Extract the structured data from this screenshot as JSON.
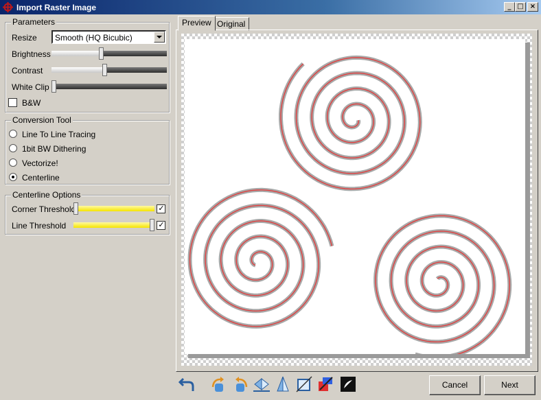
{
  "window": {
    "title": "Import Raster Image"
  },
  "parameters": {
    "title": "Parameters",
    "resize_label": "Resize",
    "resize_value": "Smooth (HQ Bicubic)",
    "brightness_label": "Brightness",
    "brightness_level": 0.43,
    "contrast_label": "Contrast",
    "contrast_level": 0.46,
    "whiteclip_label": "White Clip",
    "whiteclip_level": 0.0,
    "bw_label": "B&W",
    "bw_checked": false
  },
  "conversion": {
    "title": "Conversion Tool",
    "options": [
      {
        "label": "Line To Line Tracing",
        "selected": false
      },
      {
        "label": "1bit BW Dithering",
        "selected": false
      },
      {
        "label": "Vectorize!",
        "selected": false
      },
      {
        "label": "Centerline",
        "selected": true
      }
    ]
  },
  "centerline": {
    "title": "Centerline Options",
    "corner_label": "Corner Threshold",
    "corner_level": 0.0,
    "corner_checked": true,
    "line_label": "Line Threshold",
    "line_level": 1.0,
    "line_checked": true
  },
  "tabs": [
    {
      "label": "Preview",
      "active": true
    },
    {
      "label": "Original",
      "active": false
    }
  ],
  "toolbar_icons": [
    "undo-icon",
    "rotate-left-icon",
    "rotate-right-icon",
    "flip-horizontal-icon",
    "flip-vertical-icon",
    "crop-icon",
    "color-picker-icon",
    "invert-icon"
  ],
  "buttons": {
    "cancel": "Cancel",
    "next": "Next"
  },
  "colors": {
    "accent_title": "#0a246a",
    "stroke_red": "#e04040",
    "stroke_gray": "#a8a8a8",
    "slider_yellow": "#f5e400"
  }
}
